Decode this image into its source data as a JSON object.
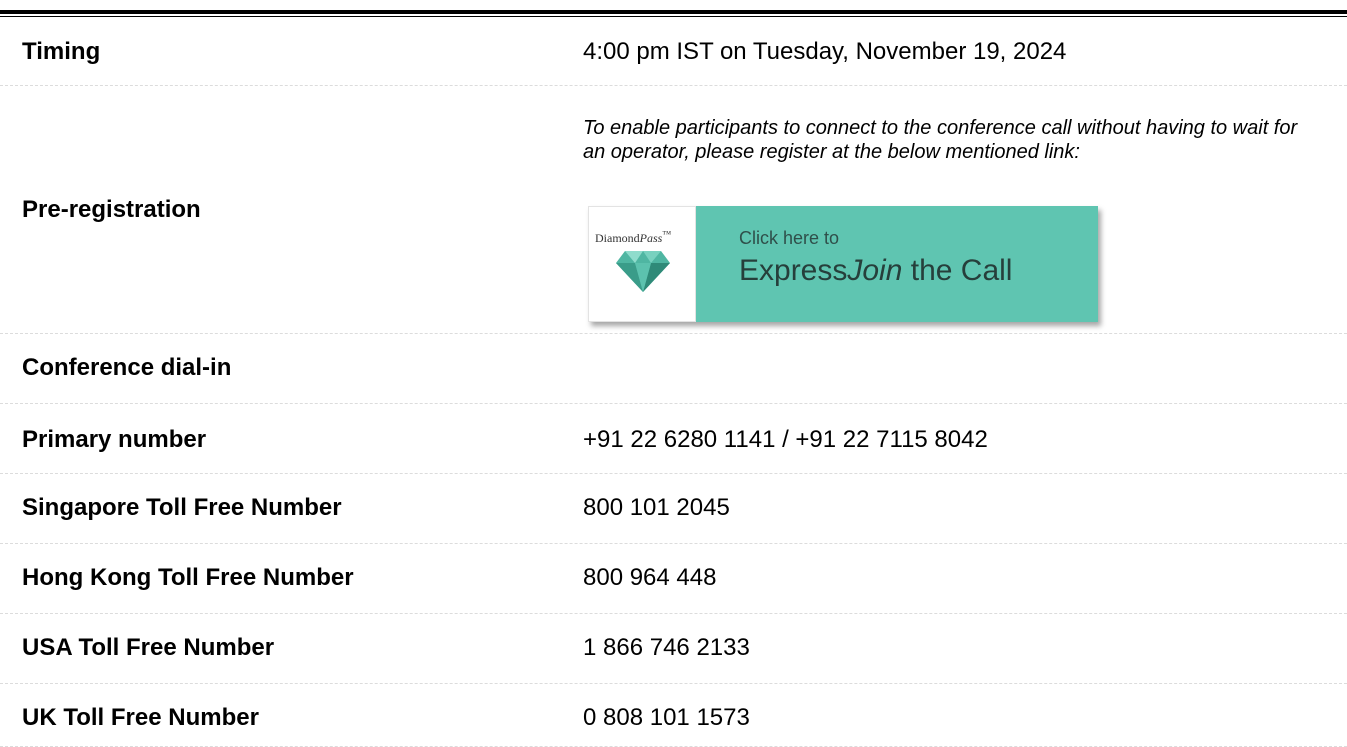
{
  "rows": [
    {
      "label": "Timing",
      "value": "4:00 pm IST on Tuesday, November 19, 2024"
    },
    {
      "label": "Pre-registration",
      "note": "To enable participants to connect to the conference call without having to wait for an operator, please register at the below mentioned link:",
      "button": {
        "logo_text": "Diamond",
        "logo_text_italic": "Pass",
        "logo_tm": "™",
        "line1": "Click here to",
        "line2_pre": "Express",
        "line2_italic": "Join",
        "line2_post": " the Call"
      }
    },
    {
      "label": "Conference dial-in",
      "value": ""
    },
    {
      "label": "Primary number",
      "value": "+91 22 6280 1141 / +91 22 7115 8042"
    },
    {
      "label": "Singapore Toll Free Number",
      "value": "800 101 2045"
    },
    {
      "label": "Hong Kong Toll Free Number",
      "value": "800 964 448"
    },
    {
      "label": "USA Toll Free Number",
      "value": "1 866 746 2133"
    },
    {
      "label": "UK Toll Free Number",
      "value": "0 808 101 1573"
    }
  ],
  "colors": {
    "button_accent": "#5fc5b1",
    "gem": "#4fb6a2",
    "divider": "#dcdcdc"
  }
}
